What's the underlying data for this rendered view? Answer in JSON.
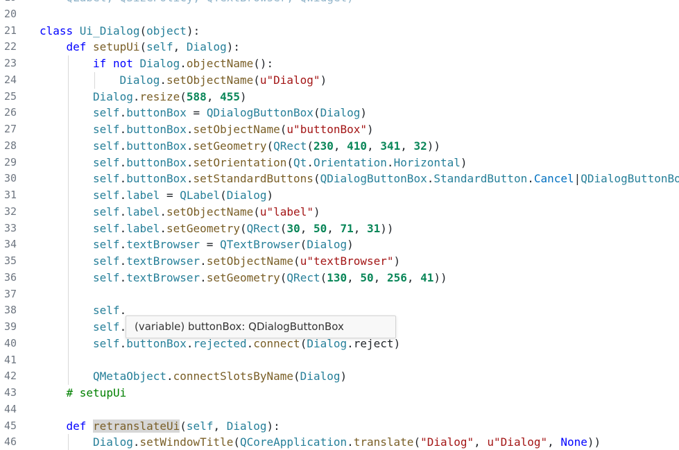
{
  "editor": {
    "language": "python",
    "lines": [
      {
        "n": "19",
        "indent": 1,
        "tokens": [
          {
            "t": "QLabel, QSizePolicy, QTextBrowser, QWidget)",
            "c": "dim"
          }
        ]
      },
      {
        "n": "20",
        "indent": 0,
        "tokens": []
      },
      {
        "n": "21",
        "indent": 0,
        "tokens": [
          {
            "t": "class ",
            "c": "kw"
          },
          {
            "t": "Ui_Dialog",
            "c": "cls"
          },
          {
            "t": "(",
            "c": "p"
          },
          {
            "t": "object",
            "c": "cls"
          },
          {
            "t": "):",
            "c": "p"
          }
        ]
      },
      {
        "n": "22",
        "indent": 1,
        "tokens": [
          {
            "t": "def ",
            "c": "kw"
          },
          {
            "t": "setupUi",
            "c": "fn"
          },
          {
            "t": "(",
            "c": "p"
          },
          {
            "t": "self",
            "c": "self"
          },
          {
            "t": ", ",
            "c": "p"
          },
          {
            "t": "Dialog",
            "c": "self"
          },
          {
            "t": "):",
            "c": "p"
          }
        ]
      },
      {
        "n": "23",
        "indent": 2,
        "tokens": [
          {
            "t": "if ",
            "c": "kw"
          },
          {
            "t": "not ",
            "c": "kw"
          },
          {
            "t": "Dialog",
            "c": "self"
          },
          {
            "t": ".",
            "c": "p"
          },
          {
            "t": "objectName",
            "c": "fn"
          },
          {
            "t": "():",
            "c": "p"
          }
        ]
      },
      {
        "n": "24",
        "indent": 3,
        "tokens": [
          {
            "t": "Dialog",
            "c": "self"
          },
          {
            "t": ".",
            "c": "p"
          },
          {
            "t": "setObjectName",
            "c": "fn"
          },
          {
            "t": "(",
            "c": "p"
          },
          {
            "t": "u\"Dialog\"",
            "c": "str"
          },
          {
            "t": ")",
            "c": "p"
          }
        ]
      },
      {
        "n": "25",
        "indent": 2,
        "tokens": [
          {
            "t": "Dialog",
            "c": "self"
          },
          {
            "t": ".",
            "c": "p"
          },
          {
            "t": "resize",
            "c": "fn"
          },
          {
            "t": "(",
            "c": "p"
          },
          {
            "t": "588",
            "c": "num"
          },
          {
            "t": ", ",
            "c": "p"
          },
          {
            "t": "455",
            "c": "num"
          },
          {
            "t": ")",
            "c": "p"
          }
        ]
      },
      {
        "n": "26",
        "indent": 2,
        "tokens": [
          {
            "t": "self",
            "c": "self"
          },
          {
            "t": ".",
            "c": "p"
          },
          {
            "t": "buttonBox",
            "c": "self"
          },
          {
            "t": " = ",
            "c": "p"
          },
          {
            "t": "QDialogButtonBox",
            "c": "cls"
          },
          {
            "t": "(",
            "c": "p"
          },
          {
            "t": "Dialog",
            "c": "self"
          },
          {
            "t": ")",
            "c": "p"
          }
        ]
      },
      {
        "n": "27",
        "indent": 2,
        "tokens": [
          {
            "t": "self",
            "c": "self"
          },
          {
            "t": ".",
            "c": "p"
          },
          {
            "t": "buttonBox",
            "c": "self"
          },
          {
            "t": ".",
            "c": "p"
          },
          {
            "t": "setObjectName",
            "c": "fn"
          },
          {
            "t": "(",
            "c": "p"
          },
          {
            "t": "u\"buttonBox\"",
            "c": "str"
          },
          {
            "t": ")",
            "c": "p"
          }
        ]
      },
      {
        "n": "28",
        "indent": 2,
        "tokens": [
          {
            "t": "self",
            "c": "self"
          },
          {
            "t": ".",
            "c": "p"
          },
          {
            "t": "buttonBox",
            "c": "self"
          },
          {
            "t": ".",
            "c": "p"
          },
          {
            "t": "setGeometry",
            "c": "fn"
          },
          {
            "t": "(",
            "c": "p"
          },
          {
            "t": "QRect",
            "c": "cls"
          },
          {
            "t": "(",
            "c": "p"
          },
          {
            "t": "230",
            "c": "num"
          },
          {
            "t": ", ",
            "c": "p"
          },
          {
            "t": "410",
            "c": "num"
          },
          {
            "t": ", ",
            "c": "p"
          },
          {
            "t": "341",
            "c": "num"
          },
          {
            "t": ", ",
            "c": "p"
          },
          {
            "t": "32",
            "c": "num"
          },
          {
            "t": "))",
            "c": "p"
          }
        ]
      },
      {
        "n": "29",
        "indent": 2,
        "tokens": [
          {
            "t": "self",
            "c": "self"
          },
          {
            "t": ".",
            "c": "p"
          },
          {
            "t": "buttonBox",
            "c": "self"
          },
          {
            "t": ".",
            "c": "p"
          },
          {
            "t": "setOrientation",
            "c": "fn"
          },
          {
            "t": "(",
            "c": "p"
          },
          {
            "t": "Qt",
            "c": "cls"
          },
          {
            "t": ".",
            "c": "p"
          },
          {
            "t": "Orientation",
            "c": "cls"
          },
          {
            "t": ".",
            "c": "p"
          },
          {
            "t": "Horizontal",
            "c": "cls"
          },
          {
            "t": ")",
            "c": "p"
          }
        ]
      },
      {
        "n": "30",
        "indent": 2,
        "tokens": [
          {
            "t": "self",
            "c": "self"
          },
          {
            "t": ".",
            "c": "p"
          },
          {
            "t": "buttonBox",
            "c": "self"
          },
          {
            "t": ".",
            "c": "p"
          },
          {
            "t": "setStandardButtons",
            "c": "fn"
          },
          {
            "t": "(",
            "c": "p"
          },
          {
            "t": "QDialogButtonBox",
            "c": "cls"
          },
          {
            "t": ".",
            "c": "p"
          },
          {
            "t": "StandardButton",
            "c": "cls"
          },
          {
            "t": ".",
            "c": "p"
          },
          {
            "t": "Cancel",
            "c": "enm"
          },
          {
            "t": "|",
            "c": "p"
          },
          {
            "t": "QDialogButtonBox",
            "c": "cls"
          }
        ]
      },
      {
        "n": "31",
        "indent": 2,
        "tokens": [
          {
            "t": "self",
            "c": "self"
          },
          {
            "t": ".",
            "c": "p"
          },
          {
            "t": "label",
            "c": "self"
          },
          {
            "t": " = ",
            "c": "p"
          },
          {
            "t": "QLabel",
            "c": "cls"
          },
          {
            "t": "(",
            "c": "p"
          },
          {
            "t": "Dialog",
            "c": "self"
          },
          {
            "t": ")",
            "c": "p"
          }
        ]
      },
      {
        "n": "32",
        "indent": 2,
        "tokens": [
          {
            "t": "self",
            "c": "self"
          },
          {
            "t": ".",
            "c": "p"
          },
          {
            "t": "label",
            "c": "self"
          },
          {
            "t": ".",
            "c": "p"
          },
          {
            "t": "setObjectName",
            "c": "fn"
          },
          {
            "t": "(",
            "c": "p"
          },
          {
            "t": "u\"label\"",
            "c": "str"
          },
          {
            "t": ")",
            "c": "p"
          }
        ]
      },
      {
        "n": "33",
        "indent": 2,
        "tokens": [
          {
            "t": "self",
            "c": "self"
          },
          {
            "t": ".",
            "c": "p"
          },
          {
            "t": "label",
            "c": "self"
          },
          {
            "t": ".",
            "c": "p"
          },
          {
            "t": "setGeometry",
            "c": "fn"
          },
          {
            "t": "(",
            "c": "p"
          },
          {
            "t": "QRect",
            "c": "cls"
          },
          {
            "t": "(",
            "c": "p"
          },
          {
            "t": "30",
            "c": "num"
          },
          {
            "t": ", ",
            "c": "p"
          },
          {
            "t": "50",
            "c": "num"
          },
          {
            "t": ", ",
            "c": "p"
          },
          {
            "t": "71",
            "c": "num"
          },
          {
            "t": ", ",
            "c": "p"
          },
          {
            "t": "31",
            "c": "num"
          },
          {
            "t": "))",
            "c": "p"
          }
        ]
      },
      {
        "n": "34",
        "indent": 2,
        "tokens": [
          {
            "t": "self",
            "c": "self"
          },
          {
            "t": ".",
            "c": "p"
          },
          {
            "t": "textBrowser",
            "c": "self"
          },
          {
            "t": " = ",
            "c": "p"
          },
          {
            "t": "QTextBrowser",
            "c": "cls"
          },
          {
            "t": "(",
            "c": "p"
          },
          {
            "t": "Dialog",
            "c": "self"
          },
          {
            "t": ")",
            "c": "p"
          }
        ]
      },
      {
        "n": "35",
        "indent": 2,
        "tokens": [
          {
            "t": "self",
            "c": "self"
          },
          {
            "t": ".",
            "c": "p"
          },
          {
            "t": "textBrowser",
            "c": "self"
          },
          {
            "t": ".",
            "c": "p"
          },
          {
            "t": "setObjectName",
            "c": "fn"
          },
          {
            "t": "(",
            "c": "p"
          },
          {
            "t": "u\"textBrowser\"",
            "c": "str"
          },
          {
            "t": ")",
            "c": "p"
          }
        ]
      },
      {
        "n": "36",
        "indent": 2,
        "tokens": [
          {
            "t": "self",
            "c": "self"
          },
          {
            "t": ".",
            "c": "p"
          },
          {
            "t": "textBrowser",
            "c": "self"
          },
          {
            "t": ".",
            "c": "p"
          },
          {
            "t": "setGeometry",
            "c": "fn"
          },
          {
            "t": "(",
            "c": "p"
          },
          {
            "t": "QRect",
            "c": "cls"
          },
          {
            "t": "(",
            "c": "p"
          },
          {
            "t": "130",
            "c": "num"
          },
          {
            "t": ", ",
            "c": "p"
          },
          {
            "t": "50",
            "c": "num"
          },
          {
            "t": ", ",
            "c": "p"
          },
          {
            "t": "256",
            "c": "num"
          },
          {
            "t": ", ",
            "c": "p"
          },
          {
            "t": "41",
            "c": "num"
          },
          {
            "t": "))",
            "c": "p"
          }
        ]
      },
      {
        "n": "37",
        "indent": 2,
        "tokens": []
      },
      {
        "n": "38",
        "indent": 2,
        "tokens": [
          {
            "t": "self",
            "c": "self"
          },
          {
            "t": ".",
            "c": "p"
          }
        ]
      },
      {
        "n": "39",
        "indent": 2,
        "tokens": [
          {
            "t": "self",
            "c": "self"
          },
          {
            "t": ".",
            "c": "p"
          }
        ]
      },
      {
        "n": "40",
        "indent": 2,
        "tokens": [
          {
            "t": "self",
            "c": "self"
          },
          {
            "t": ".",
            "c": "p"
          },
          {
            "t": "buttonBox",
            "c": "self"
          },
          {
            "t": ".",
            "c": "p"
          },
          {
            "t": "rejected",
            "c": "self"
          },
          {
            "t": ".",
            "c": "p"
          },
          {
            "t": "connect",
            "c": "fn"
          },
          {
            "t": "(",
            "c": "p"
          },
          {
            "t": "Dialog",
            "c": "self"
          },
          {
            "t": ".",
            "c": "p"
          },
          {
            "t": "reject",
            "c": "p"
          },
          {
            "t": ")",
            "c": "p"
          }
        ]
      },
      {
        "n": "41",
        "indent": 2,
        "tokens": []
      },
      {
        "n": "42",
        "indent": 2,
        "tokens": [
          {
            "t": "QMetaObject",
            "c": "cls"
          },
          {
            "t": ".",
            "c": "p"
          },
          {
            "t": "connectSlotsByName",
            "c": "fn"
          },
          {
            "t": "(",
            "c": "p"
          },
          {
            "t": "Dialog",
            "c": "self"
          },
          {
            "t": ")",
            "c": "p"
          }
        ]
      },
      {
        "n": "43",
        "indent": 1,
        "tokens": [
          {
            "t": "# setupUi",
            "c": "cmt"
          }
        ]
      },
      {
        "n": "44",
        "indent": 1,
        "tokens": []
      },
      {
        "n": "45",
        "indent": 1,
        "tokens": [
          {
            "t": "def ",
            "c": "kw"
          },
          {
            "t": "retranslateUi",
            "c": "fn hl"
          },
          {
            "t": "(",
            "c": "p"
          },
          {
            "t": "self",
            "c": "self"
          },
          {
            "t": ", ",
            "c": "p"
          },
          {
            "t": "Dialog",
            "c": "self"
          },
          {
            "t": "):",
            "c": "p"
          }
        ]
      },
      {
        "n": "46",
        "indent": 2,
        "tokens": [
          {
            "t": "Dialog",
            "c": "self"
          },
          {
            "t": ".",
            "c": "p"
          },
          {
            "t": "setWindowTitle",
            "c": "fn"
          },
          {
            "t": "(",
            "c": "p"
          },
          {
            "t": "QCoreApplication",
            "c": "cls"
          },
          {
            "t": ".",
            "c": "p"
          },
          {
            "t": "translate",
            "c": "fn"
          },
          {
            "t": "(",
            "c": "p"
          },
          {
            "t": "\"Dialog\"",
            "c": "str"
          },
          {
            "t": ", ",
            "c": "p"
          },
          {
            "t": "u\"Dialog\"",
            "c": "str"
          },
          {
            "t": ", ",
            "c": "p"
          },
          {
            "t": "None",
            "c": "kw"
          },
          {
            "t": "))",
            "c": "p"
          }
        ]
      }
    ]
  },
  "tooltip": {
    "text": "(variable) buttonBox: QDialogButtonBox"
  },
  "colors": {
    "keyword": "#0000ff",
    "type": "#267f99",
    "function": "#795e26",
    "number": "#098658",
    "string": "#a31515",
    "comment": "#008000"
  }
}
